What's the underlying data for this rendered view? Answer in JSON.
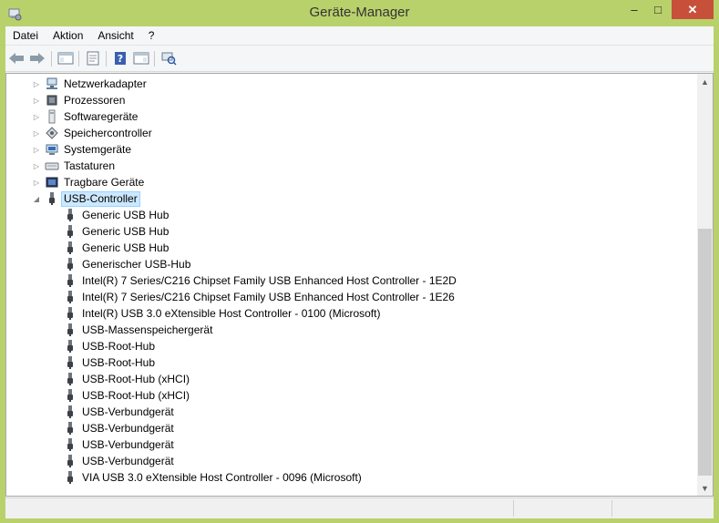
{
  "window": {
    "title": "Geräte-Manager",
    "min_glyph": "–",
    "max_glyph": "□",
    "close_glyph": "✕"
  },
  "menu": [
    "Datei",
    "Aktion",
    "Ansicht",
    "?"
  ],
  "toolbar": [
    "back-arrow-icon",
    "forward-arrow-icon",
    "show-hide-console-tree-icon",
    "properties-icon",
    "help-icon",
    "show-action-pane-icon",
    "scan-hardware-icon"
  ],
  "tree": {
    "categories": [
      {
        "label": "Netzwerkadapter",
        "icon": "network-adapter-icon",
        "expanded": false
      },
      {
        "label": "Prozessoren",
        "icon": "processor-icon",
        "expanded": false
      },
      {
        "label": "Softwaregeräte",
        "icon": "software-device-icon",
        "expanded": false
      },
      {
        "label": "Speichercontroller",
        "icon": "storage-controller-icon",
        "expanded": false
      },
      {
        "label": "Systemgeräte",
        "icon": "system-device-icon",
        "expanded": false
      },
      {
        "label": "Tastaturen",
        "icon": "keyboard-icon",
        "expanded": false
      },
      {
        "label": "Tragbare Geräte",
        "icon": "portable-device-icon",
        "expanded": false
      },
      {
        "label": "USB-Controller",
        "icon": "usb-icon",
        "expanded": true,
        "selected": true
      }
    ],
    "usb_children": [
      "Generic USB Hub",
      "Generic USB Hub",
      "Generic USB Hub",
      "Generischer USB-Hub",
      "Intel(R) 7 Series/C216 Chipset Family USB Enhanced Host Controller - 1E2D",
      "Intel(R) 7 Series/C216 Chipset Family USB Enhanced Host Controller - 1E26",
      "Intel(R) USB 3.0 eXtensible Host Controller - 0100 (Microsoft)",
      "USB-Massenspeichergerät",
      "USB-Root-Hub",
      "USB-Root-Hub",
      "USB-Root-Hub (xHCI)",
      "USB-Root-Hub (xHCI)",
      "USB-Verbundgerät",
      "USB-Verbundgerät",
      "USB-Verbundgerät",
      "USB-Verbundgerät",
      "VIA USB 3.0 eXtensible Host Controller - 0096 (Microsoft)"
    ]
  },
  "colors": {
    "frame": "#b9d16b",
    "close": "#c7503b",
    "selection": "#cce8ff"
  }
}
